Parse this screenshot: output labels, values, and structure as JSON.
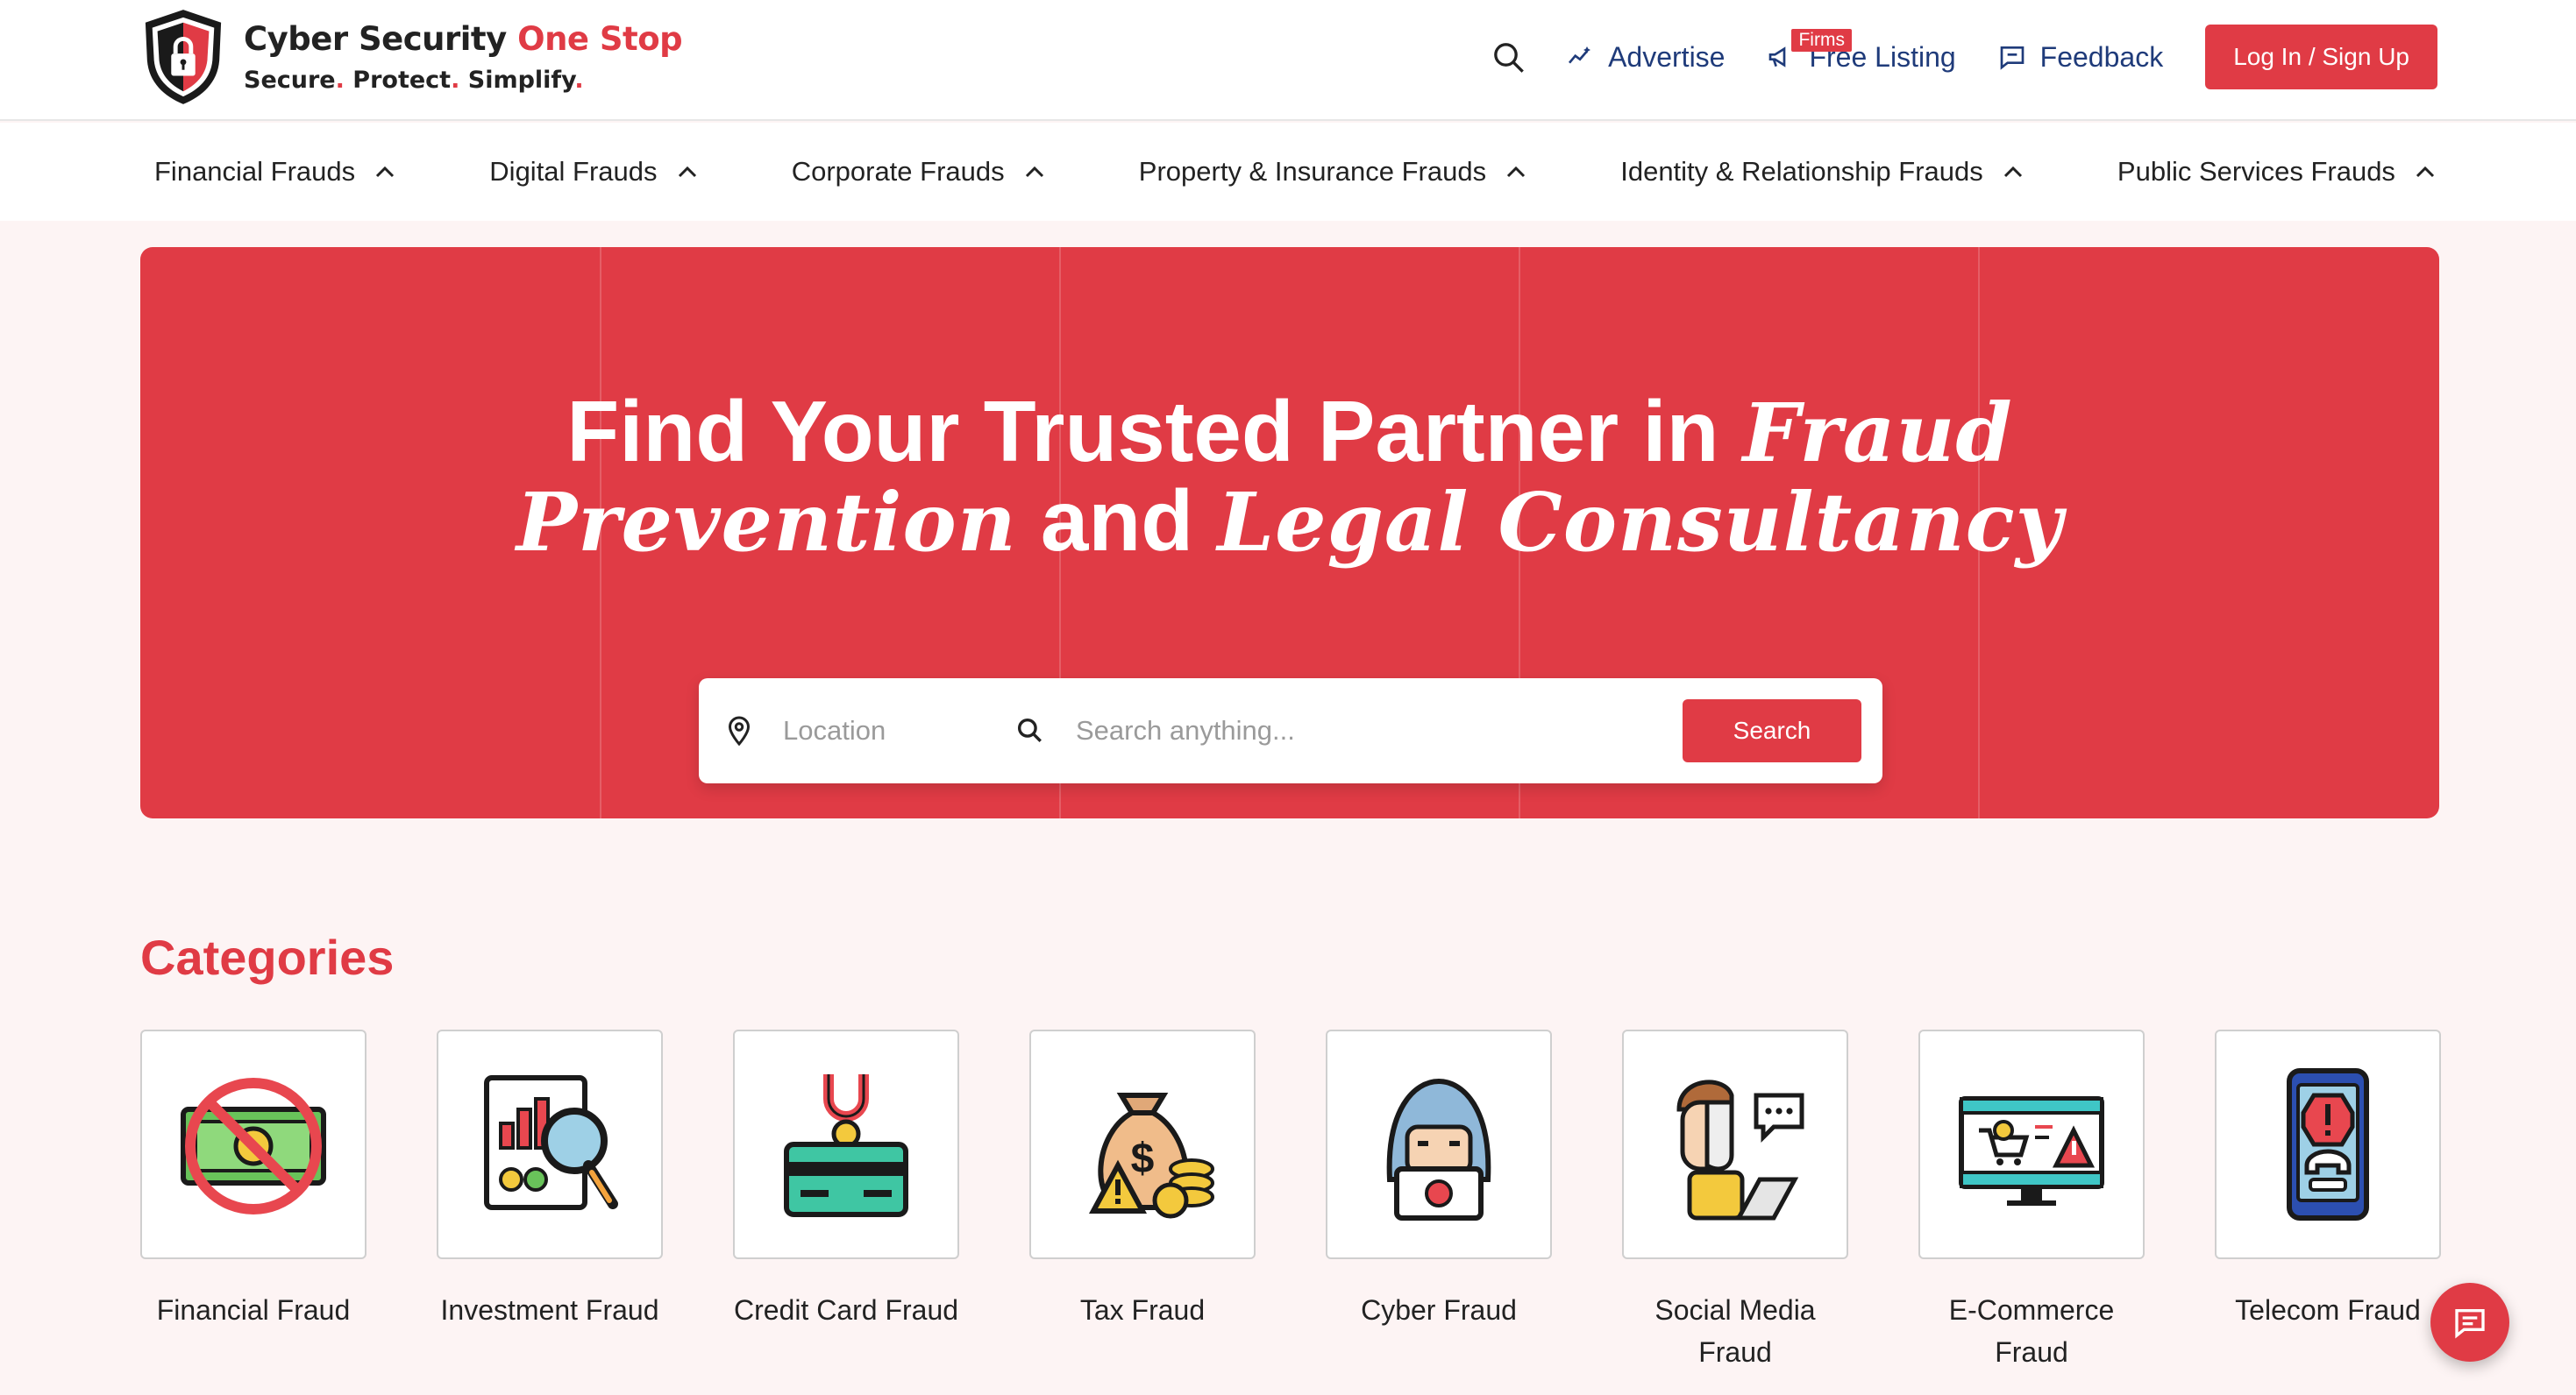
{
  "brand": {
    "title_main": "Cyber Security",
    "title_accent": "One Stop",
    "tagline_parts": [
      "Secure",
      "Protect",
      "Simplify"
    ],
    "tagline_sep": ".",
    "accent_color": "#e03b45"
  },
  "header": {
    "advertise": "Advertise",
    "free_listing": "Free Listing",
    "firms_badge": "Firms",
    "feedback": "Feedback",
    "login": "Log In / Sign Up"
  },
  "nav": {
    "items": [
      {
        "label": "Financial Frauds"
      },
      {
        "label": "Digital Frauds"
      },
      {
        "label": "Corporate Frauds"
      },
      {
        "label": "Property & Insurance Frauds"
      },
      {
        "label": "Identity & Relationship Frauds"
      },
      {
        "label": "Public Services Frauds"
      }
    ]
  },
  "hero": {
    "line1_plain": "Find Your Trusted Partner in",
    "line1_script": "Fraud",
    "line2_script_a": "Prevention",
    "line2_plain": "and",
    "line2_script_b": "Legal Consultancy"
  },
  "search": {
    "location_placeholder": "Location",
    "query_placeholder": "Search anything...",
    "button": "Search"
  },
  "categories": {
    "title": "Categories",
    "items": [
      {
        "label": "Financial Fraud",
        "icon": "no-money-icon"
      },
      {
        "label": "Investment Fraud",
        "icon": "report-magnifier-icon"
      },
      {
        "label": "Credit Card Fraud",
        "icon": "card-magnet-icon"
      },
      {
        "label": "Tax Fraud",
        "icon": "money-bag-warning-icon"
      },
      {
        "label": "Cyber Fraud",
        "icon": "hacker-icon"
      },
      {
        "label": "Social Media Fraud",
        "icon": "masked-user-icon"
      },
      {
        "label": "E-Commerce Fraud",
        "icon": "ecommerce-warning-icon"
      },
      {
        "label": "Telecom Fraud",
        "icon": "phone-alert-icon"
      }
    ]
  }
}
